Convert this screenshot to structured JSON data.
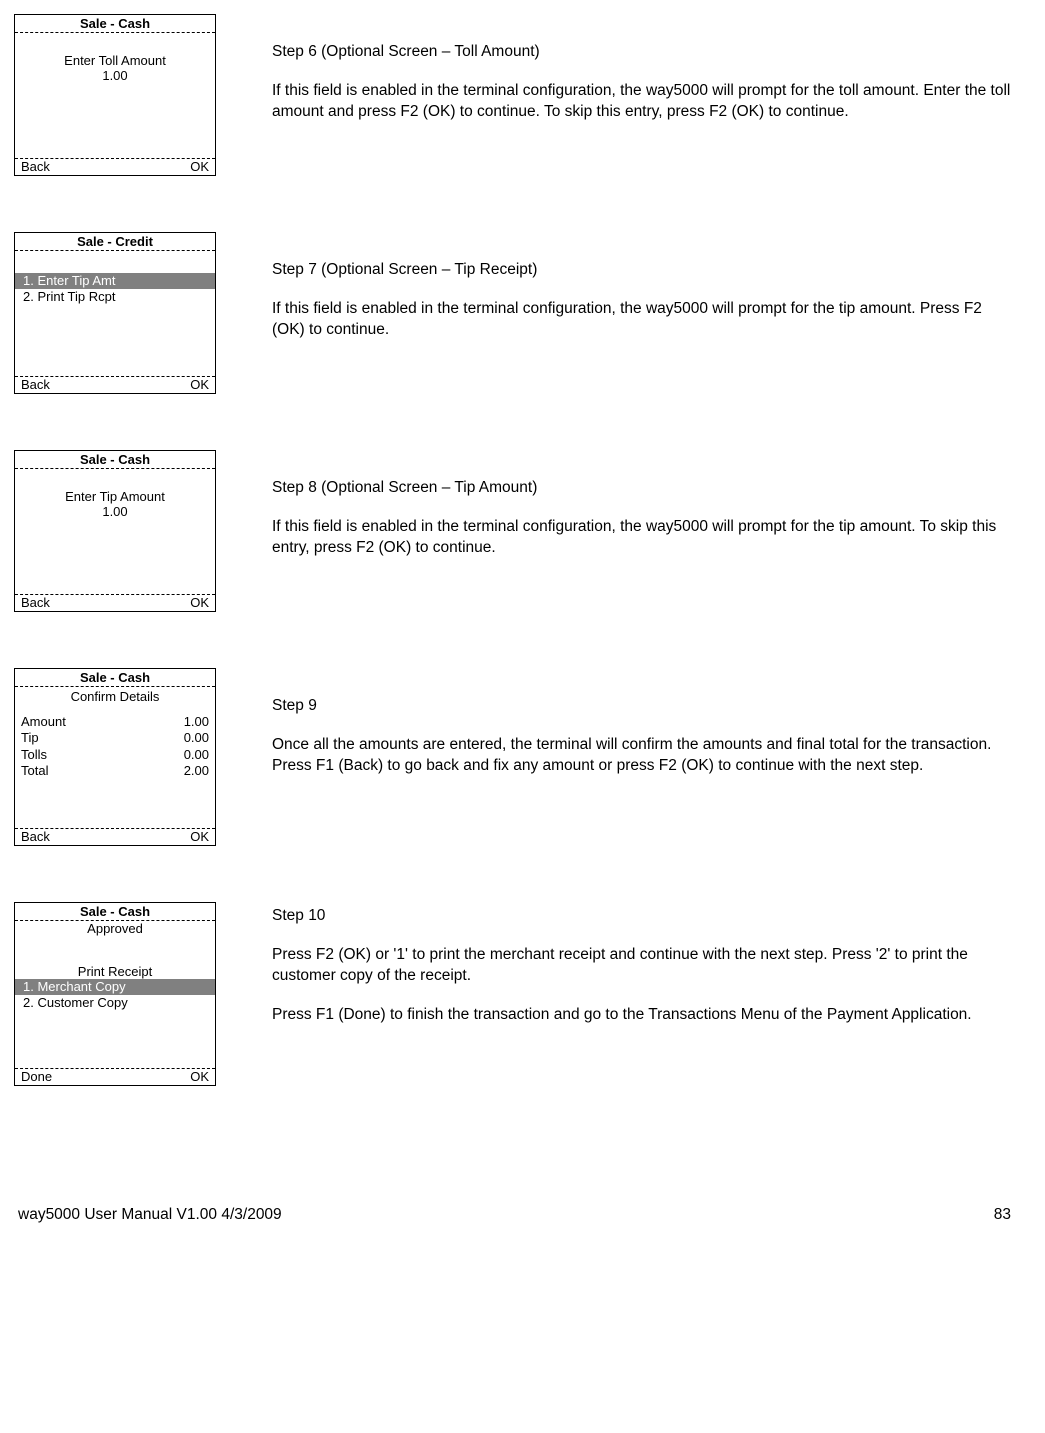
{
  "steps": [
    {
      "term_title": "Sale - Cash",
      "prompt1": "Enter Toll Amount",
      "prompt2": "1.00",
      "foot_left": "Back",
      "foot_right": "OK",
      "heading": "Step 6 (Optional Screen – Toll Amount)",
      "body": "If this field is enabled in the terminal configuration, the way5000 will prompt for the toll amount. Enter the toll amount and press F2 (OK) to continue. To skip this entry, press F2 (OK) to continue."
    },
    {
      "term_title": "Sale - Credit",
      "menu_sel": "1. Enter Tip Amt",
      "menu_opt": "2. Print Tip Rcpt",
      "foot_left": "Back",
      "foot_right": "OK",
      "heading": "Step 7 (Optional Screen – Tip Receipt)",
      "body": "If this field is enabled in the terminal configuration, the way5000 will prompt for the tip amount. Press F2 (OK) to continue."
    },
    {
      "term_title": "Sale - Cash",
      "prompt1": "Enter Tip Amount",
      "prompt2": "1.00",
      "foot_left": "Back",
      "foot_right": "OK",
      "heading": "Step 8 (Optional Screen – Tip Amount)",
      "body": "If this field is enabled in the terminal configuration, the way5000 will prompt for the tip amount. To skip this entry, press F2 (OK) to continue."
    },
    {
      "term_title": "Sale - Cash",
      "subhead": "Confirm Details",
      "rows": [
        {
          "k": "Amount",
          "v": "1.00"
        },
        {
          "k": "Tip",
          "v": "0.00"
        },
        {
          "k": "Tolls",
          "v": "0.00"
        },
        {
          "k": "Total",
          "v": "2.00"
        }
      ],
      "foot_left": "Back",
      "foot_right": "OK",
      "heading": "Step 9",
      "body": "Once all the amounts are entered, the terminal will confirm the amounts and final total for the transaction. Press F1 (Back) to go back and fix any amount or press F2 (OK) to continue with the next step."
    },
    {
      "term_title": "Sale - Cash",
      "approved": "Approved",
      "subhead2": "Print Receipt",
      "menu_sel": "1. Merchant Copy",
      "menu_opt": "2. Customer Copy",
      "foot_left": "Done",
      "foot_right": "OK",
      "heading": "Step 10",
      "body": "Press F2 (OK) or '1' to print the merchant receipt and continue with the next step.  Press '2' to print the customer copy of the receipt.",
      "body2": "Press F1 (Done) to finish the transaction and go to the Transactions Menu of the Payment Application."
    }
  ],
  "footer": {
    "left": "way5000 User Manual V1.00     4/3/2009",
    "right": "83"
  }
}
